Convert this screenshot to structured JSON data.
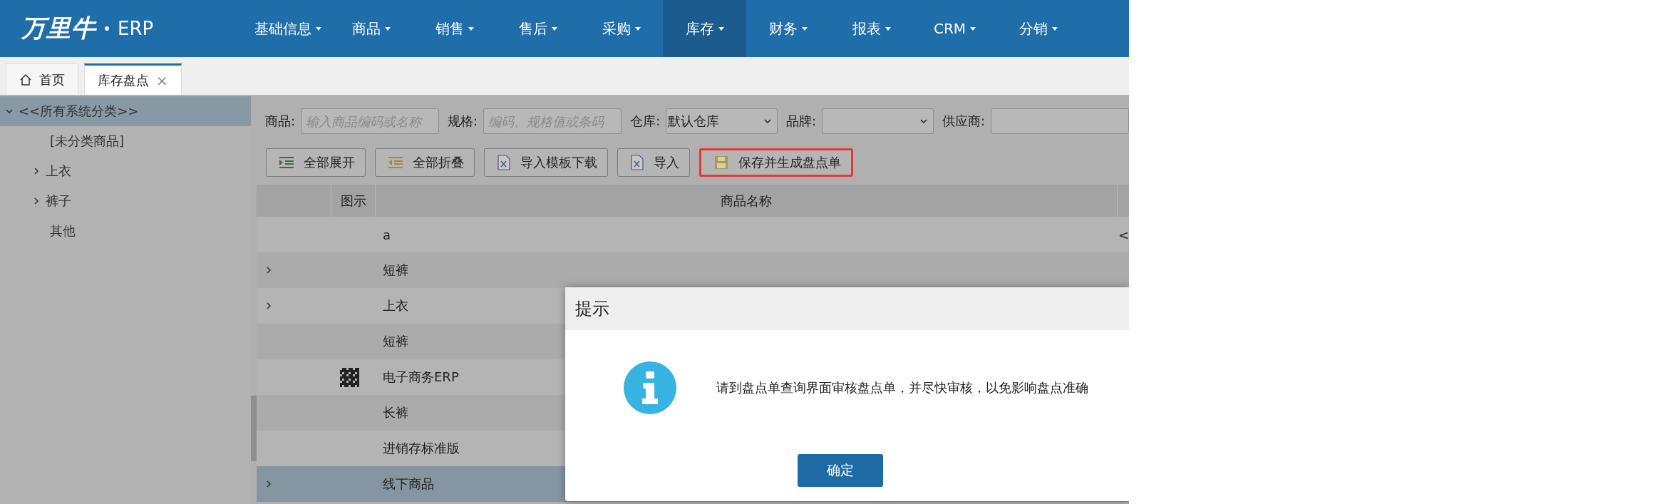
{
  "app": {
    "brand": "万里牛",
    "product": "ERP"
  },
  "menu": [
    {
      "label": "基础信息",
      "selected": false
    },
    {
      "label": "商品",
      "selected": false
    },
    {
      "label": "销售",
      "selected": false
    },
    {
      "label": "售后",
      "selected": false
    },
    {
      "label": "采购",
      "selected": false
    },
    {
      "label": "库存",
      "selected": true
    },
    {
      "label": "财务",
      "selected": false
    },
    {
      "label": "报表",
      "selected": false
    },
    {
      "label": "CRM",
      "selected": false
    },
    {
      "label": "分销",
      "selected": false
    }
  ],
  "tabs": [
    {
      "label": "首页",
      "kind": "home",
      "selected": false
    },
    {
      "label": "库存盘点",
      "kind": "page",
      "selected": true,
      "close": "×"
    }
  ],
  "tree": [
    {
      "label": "<<所有系统分类>>",
      "expanded": true,
      "selected": true,
      "children": [
        {
          "label": "[未分类商品]",
          "selected": false
        },
        {
          "label": "上衣",
          "expanded": false,
          "selected": false
        },
        {
          "label": "裤子",
          "expanded": false,
          "selected": false
        },
        {
          "label": "其他",
          "selected": false
        }
      ]
    }
  ],
  "filters": [
    {
      "label": "商品:",
      "kind": "input",
      "placeholder": "输入商品编码或名称"
    },
    {
      "label": "规格:",
      "kind": "input",
      "placeholder": "编码、规格值或条码"
    },
    {
      "label": "仓库:",
      "kind": "select",
      "value": "默认仓库"
    },
    {
      "label": "品牌:",
      "kind": "select"
    },
    {
      "label": "供应商:",
      "kind": "input"
    }
  ],
  "toolbar": [
    {
      "label": "全部展开",
      "highlighted": false
    },
    {
      "label": "全部折叠",
      "highlighted": false
    },
    {
      "label": "导入模板下载",
      "highlighted": false
    },
    {
      "label": "导入",
      "highlighted": false
    },
    {
      "label": "保存并生成盘点单",
      "highlighted": true
    }
  ],
  "table": {
    "columns": [
      {
        "label": "图示"
      },
      {
        "label": "商品名称"
      }
    ],
    "rows": [
      {
        "name": "a",
        "column_4": "<",
        "expandable": false,
        "has_image": false,
        "selected": false
      },
      {
        "name": "短裤",
        "expandable": true,
        "has_image": false,
        "selected": false
      },
      {
        "name": "上衣",
        "expandable": true,
        "has_image": false,
        "selected": false
      },
      {
        "name": "短裤",
        "expandable": false,
        "has_image": false,
        "selected": false
      },
      {
        "name": "电子商务ERP",
        "expandable": false,
        "has_image": true,
        "selected": false
      },
      {
        "name": "长裤",
        "expandable": false,
        "has_image": false,
        "selected": false
      },
      {
        "name": "进销存标准版",
        "expandable": false,
        "has_image": false,
        "selected": false
      },
      {
        "name": "线下商品",
        "expandable": true,
        "has_image": false,
        "selected": true
      }
    ]
  },
  "dialog": {
    "title": "提示",
    "message": "请到盘点单查询界面审核盘点单，并尽快审核，以免影响盘点准确",
    "button": "确定"
  }
}
